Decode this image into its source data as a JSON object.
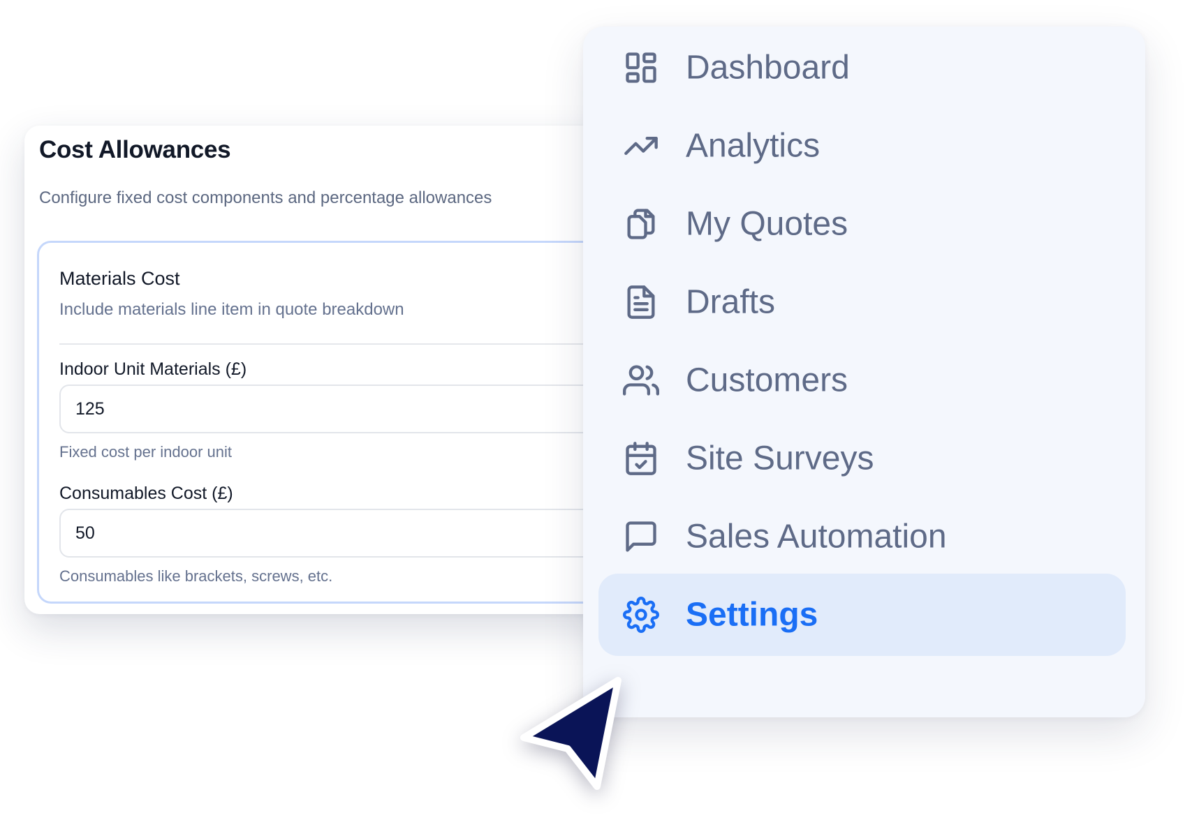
{
  "cost_allowances": {
    "title": "Cost Allowances",
    "subtitle": "Configure fixed cost components and percentage allowances",
    "materials": {
      "title": "Materials Cost",
      "description": "Include materials line item in quote breakdown",
      "fields": [
        {
          "label": "Indoor Unit Materials (£)",
          "value": "125",
          "help": "Fixed cost per indoor unit"
        },
        {
          "label": "Consumables Cost (£)",
          "value": "50",
          "help": "Consumables like brackets, screws, etc."
        }
      ]
    }
  },
  "sidebar": {
    "active_item": "Settings",
    "items": [
      {
        "label": "Dashboard",
        "icon": "dashboard-icon"
      },
      {
        "label": "Analytics",
        "icon": "trending-up-icon"
      },
      {
        "label": "My Quotes",
        "icon": "copy-documents-icon"
      },
      {
        "label": "Drafts",
        "icon": "file-text-icon"
      },
      {
        "label": "Customers",
        "icon": "users-icon"
      },
      {
        "label": "Site Surveys",
        "icon": "calendar-check-icon"
      },
      {
        "label": "Sales Automation",
        "icon": "message-square-icon"
      },
      {
        "label": "Settings",
        "icon": "gear-icon"
      }
    ]
  },
  "colors": {
    "accent": "#1a6ef5",
    "active_bg": "#e1ebfb",
    "nav_text": "#5e6a87",
    "cursor": "#0a1457"
  }
}
